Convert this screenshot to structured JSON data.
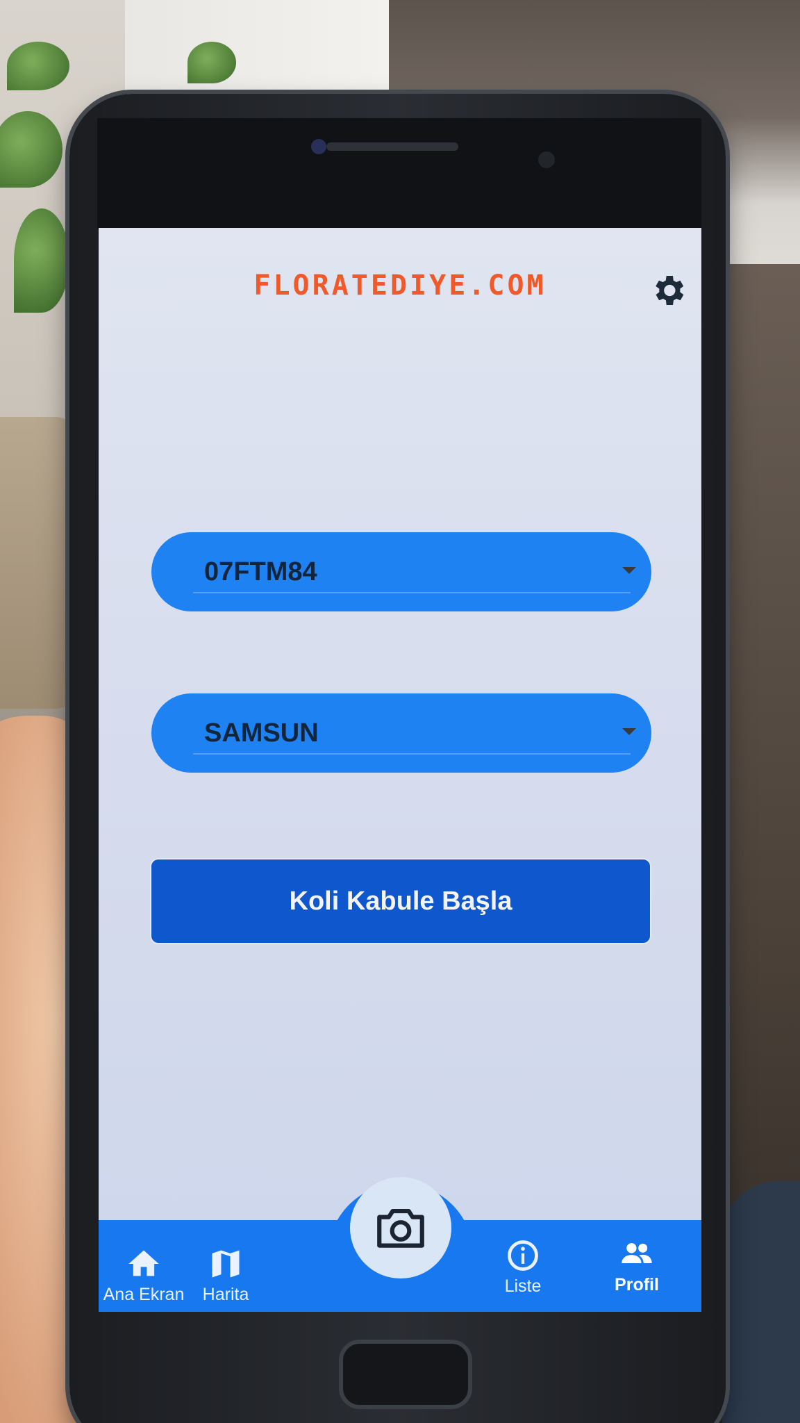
{
  "app": {
    "brand": "FLORATEDIYE.COM"
  },
  "header": {
    "settings_icon": "gear-icon"
  },
  "form": {
    "dropdown_code": {
      "value": "07FTM84"
    },
    "dropdown_city": {
      "value": "SAMSUN"
    },
    "start_button_label": "Koli Kabule Başla"
  },
  "bottom_nav": {
    "items": [
      {
        "label": "Ana Ekran",
        "icon": "home-icon"
      },
      {
        "label": "Harita",
        "icon": "map-icon"
      },
      {
        "label": "Liste",
        "icon": "info-icon"
      },
      {
        "label": "Profil",
        "icon": "group-icon"
      }
    ],
    "center_action_icon": "camera-icon"
  },
  "colors": {
    "brand": "#f05a2a",
    "dropdown_bg": "#1e82f2",
    "button_bg": "#0f57cc",
    "nav_bg": "#1778f0",
    "screen_bg": "#dde3f0"
  }
}
